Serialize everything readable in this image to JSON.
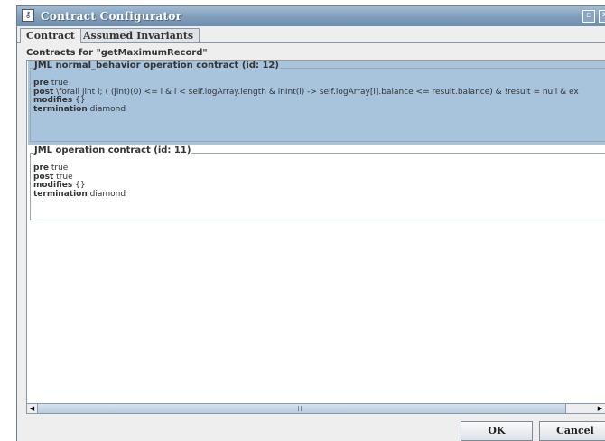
{
  "window": {
    "title": "Contract Configurator",
    "app_icon": "key-icon"
  },
  "tabs": [
    {
      "label": "Contract",
      "active": true
    },
    {
      "label": "Assumed Invariants",
      "active": false
    }
  ],
  "contracts_label": "Contracts for \"getMaximumRecord\"",
  "contracts": [
    {
      "title": "JML normal_behavior operation contract (id: 12)",
      "selected": true,
      "pre_kw": "pre",
      "pre": "true",
      "post_kw": "post",
      "post": "\\forall jint i; ( (jint)(0) <= i & i < self.logArray.length & inInt(i) -> self.logArray[i].balance <= result.balance) & !result = null & ex",
      "modifies_kw": "modifies",
      "modifies": "{}",
      "termination_kw": "termination",
      "termination": "diamond"
    },
    {
      "title": "JML operation contract (id: 11)",
      "selected": false,
      "pre_kw": "pre",
      "pre": "true",
      "post_kw": "post",
      "post": "true",
      "modifies_kw": "modifies",
      "modifies": "{}",
      "termination_kw": "termination",
      "termination": "diamond"
    }
  ],
  "buttons": {
    "ok": "OK",
    "cancel": "Cancel"
  },
  "colors": {
    "titlebar": "#7f9db9",
    "selection": "#a8c4dd",
    "panel": "#eeeeee"
  }
}
